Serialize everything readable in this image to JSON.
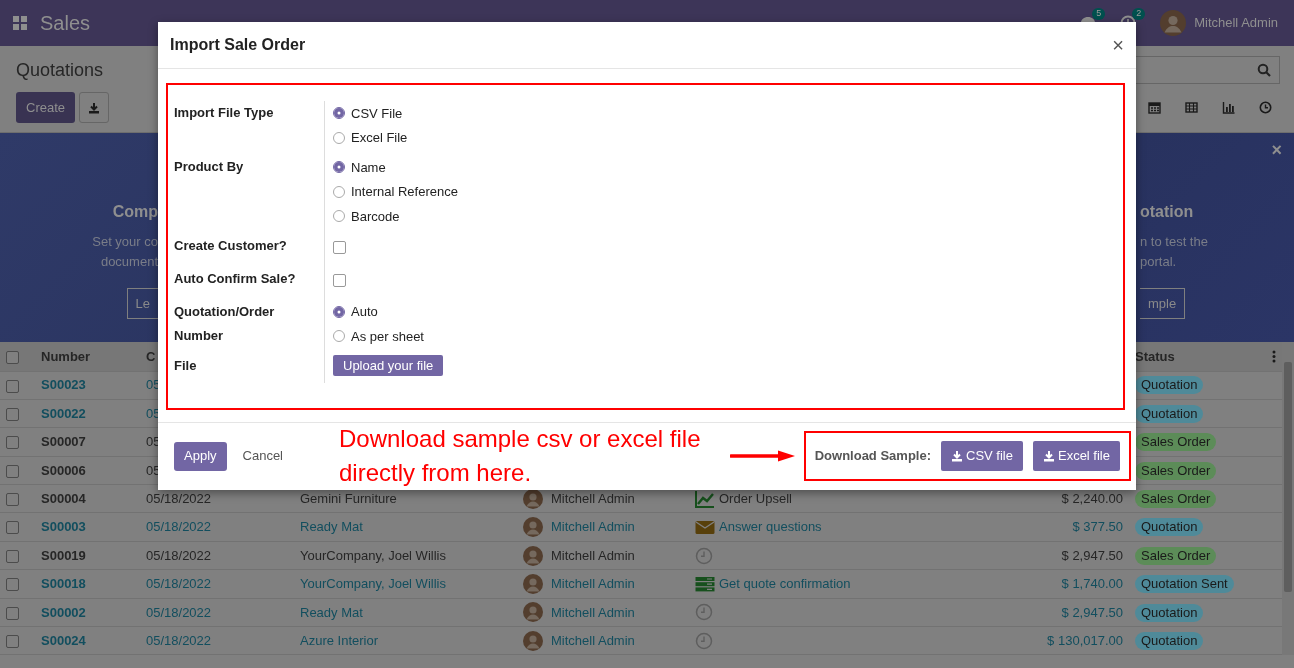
{
  "navbar": {
    "app_name": "Sales",
    "chat_count": "5",
    "activity_count": "2",
    "user": "Mitchell Admin"
  },
  "control_panel": {
    "title": "Quotations",
    "create_button": "Create"
  },
  "banner": {
    "left": {
      "title": "Comp",
      "text_lines": [
        "Set your co",
        "document"
      ],
      "button": "Le"
    },
    "right": {
      "title": "otation",
      "text_lines": [
        "n to test the",
        "portal."
      ],
      "button": "mple"
    },
    "close": "×"
  },
  "table": {
    "select_all_checked": false,
    "columns": [
      "Number",
      "C",
      "Status"
    ],
    "rows": [
      {
        "checked": false,
        "number": "S00023",
        "date": "05",
        "link": true,
        "status": {
          "label": "Quotation",
          "color": "#4f8a99"
        }
      },
      {
        "checked": false,
        "number": "S00022",
        "date": "05",
        "link": true,
        "status": {
          "label": "Quotation",
          "color": "#4f8a99"
        }
      },
      {
        "checked": false,
        "number": "S00007",
        "date": "05",
        "link": false,
        "status": {
          "label": "Sales Order",
          "color": "#5c8c58"
        }
      },
      {
        "checked": false,
        "number": "S00006",
        "date": "05",
        "link": false,
        "status": {
          "label": "Sales Order",
          "color": "#5c8c58"
        }
      },
      {
        "checked": false,
        "number": "S00004",
        "date": "05/18/2022",
        "customer": "Gemini Furniture",
        "salesperson": "Mitchell Admin",
        "activity": {
          "kind": "chart",
          "text": "Order Upsell"
        },
        "total": "$ 2,240.00",
        "link": false,
        "status": {
          "label": "Sales Order",
          "color": "#5c8c58"
        }
      },
      {
        "checked": false,
        "number": "S00003",
        "date": "05/18/2022",
        "customer": "Ready Mat",
        "salesperson": "Mitchell Admin",
        "activity": {
          "kind": "email",
          "text": "Answer questions"
        },
        "total": "$ 377.50",
        "link": true,
        "status": {
          "label": "Quotation",
          "color": "#4f8a99"
        }
      },
      {
        "checked": false,
        "number": "S00019",
        "date": "05/18/2022",
        "customer": "YourCompany, Joel Willis",
        "salesperson": "Mitchell Admin",
        "activity": {
          "kind": "clock"
        },
        "total": "$ 2,947.50",
        "link": false,
        "status": {
          "label": "Sales Order",
          "color": "#5c8c58"
        }
      },
      {
        "checked": false,
        "number": "S00018",
        "date": "05/18/2022",
        "customer": "YourCompany, Joel Willis",
        "salesperson": "Mitchell Admin",
        "activity": {
          "kind": "list",
          "text": "Get quote confirmation"
        },
        "total": "$ 1,740.00",
        "link": true,
        "status": {
          "label": "Quotation Sent",
          "color": "#4f8a99"
        }
      },
      {
        "checked": false,
        "number": "S00002",
        "date": "05/18/2022",
        "customer": "Ready Mat",
        "salesperson": "Mitchell Admin",
        "activity": {
          "kind": "clock"
        },
        "total": "$ 2,947.50",
        "link": true,
        "status": {
          "label": "Quotation",
          "color": "#4f8a99"
        }
      },
      {
        "checked": false,
        "number": "S00024",
        "date": "05/18/2022",
        "customer": "Azure Interior",
        "salesperson": "Mitchell Admin",
        "activity": {
          "kind": "clock"
        },
        "total": "$ 130,017.00",
        "link": true,
        "status": {
          "label": "Quotation",
          "color": "#4f8a99"
        }
      }
    ]
  },
  "modal": {
    "title": "Import Sale Order",
    "close": "×",
    "fields": [
      {
        "label": "Import File Type",
        "kind": "radio",
        "options": [
          {
            "label": "CSV File",
            "selected": true
          },
          {
            "label": "Excel File",
            "selected": false
          }
        ]
      },
      {
        "label": "Product By",
        "kind": "radio",
        "options": [
          {
            "label": "Name",
            "selected": true
          },
          {
            "label": "Internal Reference",
            "selected": false
          },
          {
            "label": "Barcode",
            "selected": false
          }
        ]
      },
      {
        "label": "Create Customer?",
        "kind": "checkbox",
        "checked": false
      },
      {
        "label": "Auto Confirm Sale?",
        "kind": "checkbox",
        "checked": false
      },
      {
        "label": "Quotation/Order Number",
        "kind": "radio",
        "options": [
          {
            "label": "Auto",
            "selected": true
          },
          {
            "label": "As per sheet",
            "selected": false
          }
        ]
      },
      {
        "label": "File",
        "kind": "upload",
        "button": "Upload your file"
      }
    ],
    "buttons": [
      "Apply",
      "Cancel"
    ],
    "annotation": "Download sample csv or excel file directly from here.",
    "download": {
      "label": "Download Sample:",
      "buttons": [
        "CSV file",
        "Excel file"
      ]
    }
  }
}
